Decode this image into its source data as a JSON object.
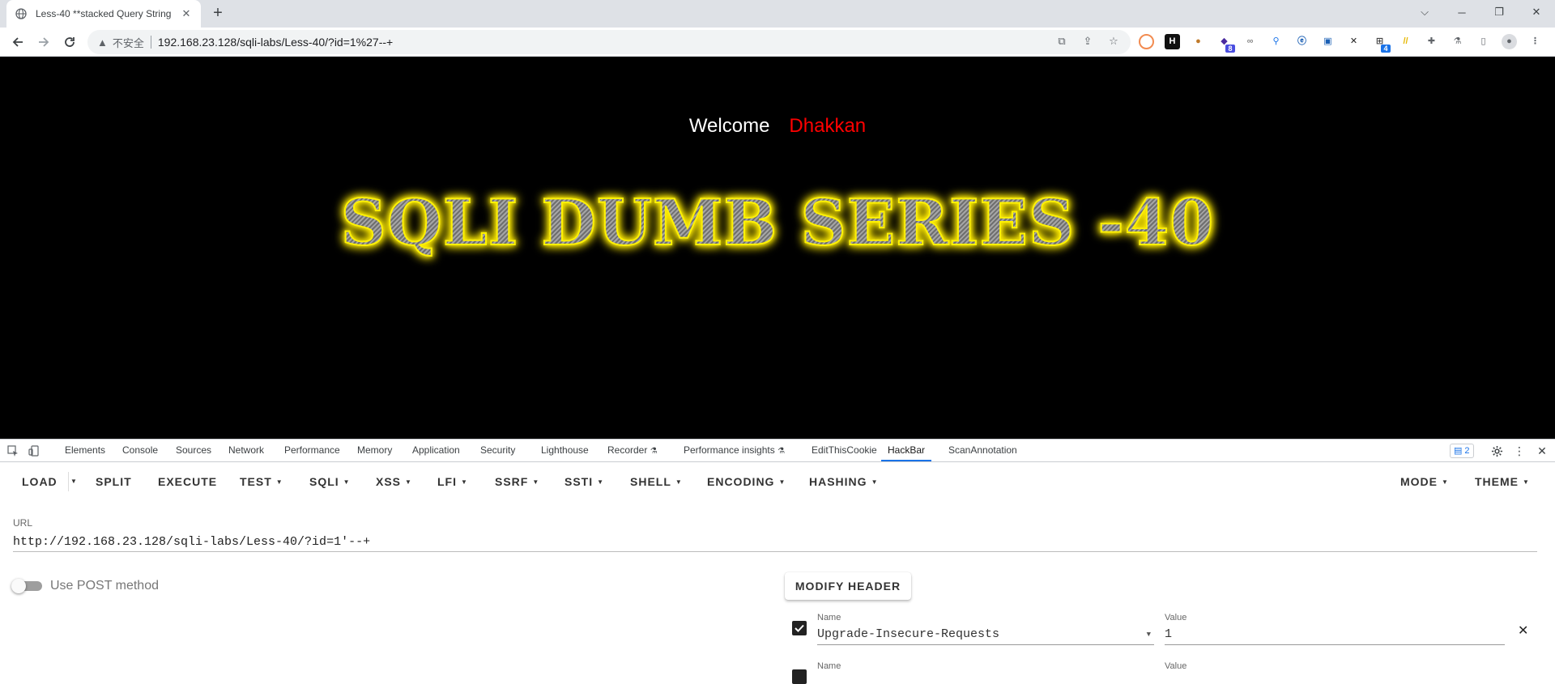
{
  "browser": {
    "tab_title": "Less-40 **stacked Query String",
    "url_security": "不安全",
    "url": "192.168.23.128/sqli-labs/Less-40/?id=1%27--+",
    "extension_badges": {
      "purple": "8",
      "blue": "4"
    }
  },
  "page": {
    "welcome_text": "Welcome",
    "welcome_user": "Dhakkan",
    "banner": "SQLI DUMB SERIES -40"
  },
  "devtools": {
    "tabs": [
      "Elements",
      "Console",
      "Sources",
      "Network",
      "Performance",
      "Memory",
      "Application",
      "Security",
      "Lighthouse",
      "Recorder",
      "Performance insights",
      "EditThisCookie",
      "HackBar",
      "ScanAnnotation"
    ],
    "active_tab": "HackBar",
    "issues_count": "2"
  },
  "hackbar": {
    "buttons": {
      "load": "LOAD",
      "split": "SPLIT",
      "execute": "EXECUTE",
      "test": "TEST",
      "sqli": "SQLI",
      "xss": "XSS",
      "lfi": "LFI",
      "ssrf": "SSRF",
      "ssti": "SSTI",
      "shell": "SHELL",
      "encoding": "ENCODING",
      "hashing": "HASHING",
      "mode": "MODE",
      "theme": "THEME"
    },
    "url_label": "URL",
    "url_value": "http://192.168.23.128/sqli-labs/Less-40/?id=1'--+",
    "post_label": "Use POST method",
    "modify_header": "MODIFY HEADER",
    "header_name_label": "Name",
    "header_value_label": "Value",
    "headers": [
      {
        "name": "Upgrade-Insecure-Requests",
        "value": "1"
      },
      {
        "name": "",
        "value": ""
      }
    ]
  },
  "colors": {
    "welcome_user": "#ff0000",
    "banner_glow": "#fff200",
    "active_tab_underline": "#1a73e8"
  }
}
